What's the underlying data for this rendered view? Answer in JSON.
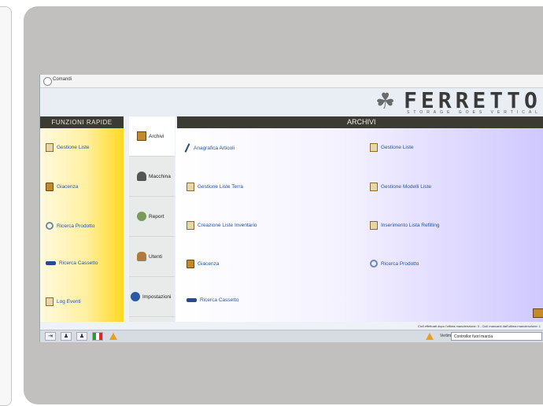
{
  "window": {
    "title": "Comandi"
  },
  "brand": {
    "name": "FERRETTO",
    "tagline": "STORAGE GOES VERTICAL"
  },
  "quick_functions": {
    "title": "FUNZIONI RAPIDE",
    "items": [
      {
        "label": "Gestione Liste",
        "icon": "list-icon"
      },
      {
        "label": "Giacenza",
        "icon": "box-icon"
      },
      {
        "label": "Ricerca Prodotto",
        "icon": "search-icon"
      },
      {
        "label": "Ricerca Cassetto",
        "icon": "tray-icon"
      },
      {
        "label": "Log Eventi",
        "icon": "log-icon"
      }
    ]
  },
  "tabs": [
    {
      "label": "Archivi",
      "icon": "archive-icon",
      "active": true
    },
    {
      "label": "Macchina",
      "icon": "machine-icon"
    },
    {
      "label": "Report",
      "icon": "report-icon"
    },
    {
      "label": "Utenti",
      "icon": "users-icon"
    },
    {
      "label": "Impostazioni",
      "icon": "settings-icon"
    }
  ],
  "archivi": {
    "title": "ARCHIVI",
    "items": [
      {
        "label": "Anagrafica Articoli",
        "icon": "pen-icon"
      },
      {
        "label": "Gestione Liste",
        "icon": "list-icon"
      },
      {
        "label": "Gestione Liste Terra",
        "icon": "list-icon"
      },
      {
        "label": "Gestione Modelli Liste",
        "icon": "list-icon"
      },
      {
        "label": "Creazione Liste Inventario",
        "icon": "list-icon"
      },
      {
        "label": "Inserimento Lista Refilling",
        "icon": "list-icon"
      },
      {
        "label": "Giacenza",
        "icon": "box-icon"
      },
      {
        "label": "Ricerca Prodotto",
        "icon": "search-icon"
      },
      {
        "label": "Ricerca Cassetto",
        "icon": "tray-icon"
      }
    ]
  },
  "footer": {
    "info": "Cicli effettuati dopo l'ultima manutenzione: 0 - Cicli mancanti dall'ultima manutenzione: 1",
    "status_label": "Vertimat",
    "status_value": "Controllor fuori marcia"
  },
  "colors": {
    "accent_yellow": "#ffd820",
    "header_dark": "#3b3b33",
    "link_blue": "#2555a0"
  }
}
